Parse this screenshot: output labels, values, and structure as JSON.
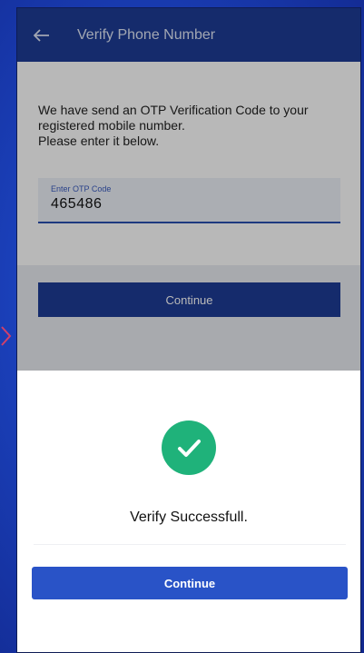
{
  "appbar": {
    "back_icon": "arrow-left-icon",
    "title": "Verify Phone Number"
  },
  "verification": {
    "message_line1": "We have send an OTP Verification Code to your registered mobile number.",
    "message_line2": "Please enter it below.",
    "otp_label": "Enter OTP Code",
    "otp_value": "465486",
    "continue_label": "Continue"
  },
  "success_sheet": {
    "icon": "check-circle-icon",
    "message": "Verify Successfull.",
    "continue_label": "Continue"
  },
  "colors": {
    "appbar": "#1e3c96",
    "success": "#1fb27a",
    "primary_button": "#2953c7",
    "page_background": "#1a3fb8"
  }
}
